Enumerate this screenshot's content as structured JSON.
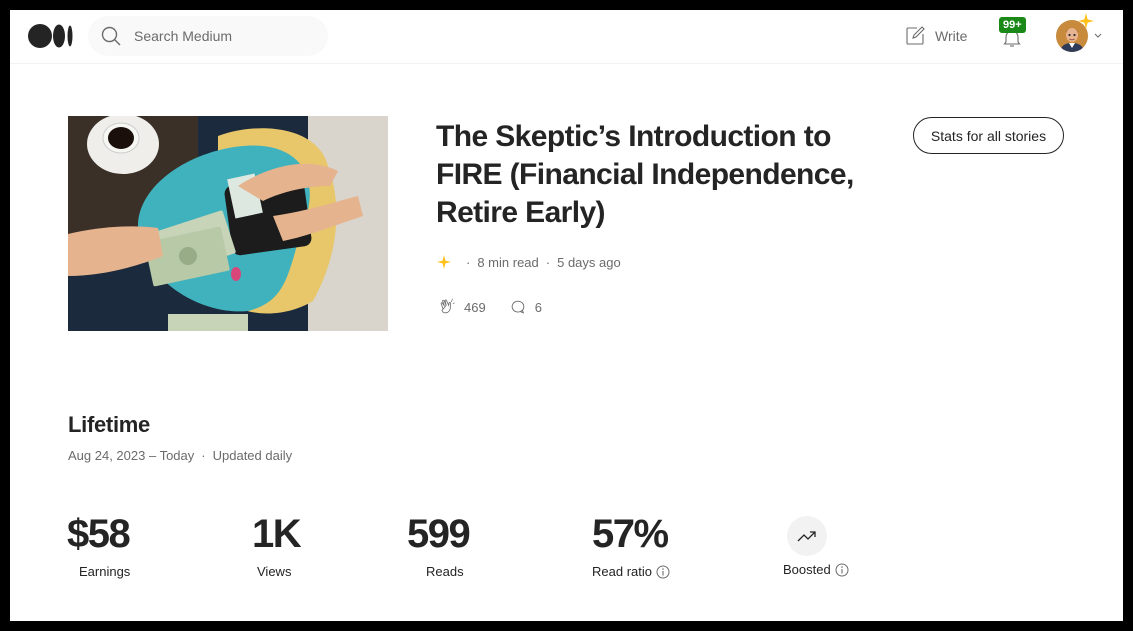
{
  "header": {
    "search_placeholder": "Search Medium",
    "write_label": "Write",
    "notifications_badge": "99+"
  },
  "article": {
    "title": "The Skeptic’s Introduction to FIRE (Financial Independence, Retire Early)",
    "stats_button_label": "Stats for all stories",
    "read_time": "8 min read",
    "posted": "5 days ago",
    "claps": "469",
    "responses": "6",
    "meta_separator": "·"
  },
  "lifetime": {
    "heading": "Lifetime",
    "date_range": "Aug 24, 2023 – Today",
    "update_note": "Updated daily",
    "separator": "·"
  },
  "stats": {
    "earnings": {
      "value": "$58",
      "label": "Earnings"
    },
    "views": {
      "value": "1K",
      "label": "Views"
    },
    "reads": {
      "value": "599",
      "label": "Reads"
    },
    "read_ratio": {
      "value": "57%",
      "label": "Read ratio"
    },
    "boosted": {
      "label": "Boosted"
    }
  },
  "colors": {
    "accent_green": "#1a8917",
    "member_star": "#ffc017",
    "text_primary": "#242424",
    "text_secondary": "#6b6b6b",
    "thumbnail_teal": "#3fb2bd",
    "thumbnail_navy": "#1b2a3d"
  },
  "icons": {
    "logo": "medium-logo-icon",
    "search": "search-icon",
    "write": "write-icon",
    "bell": "bell-icon",
    "star": "sparkle-star-icon",
    "clap": "clap-icon",
    "response": "speech-bubble-icon",
    "info": "info-icon",
    "boost": "trending-up-icon"
  }
}
